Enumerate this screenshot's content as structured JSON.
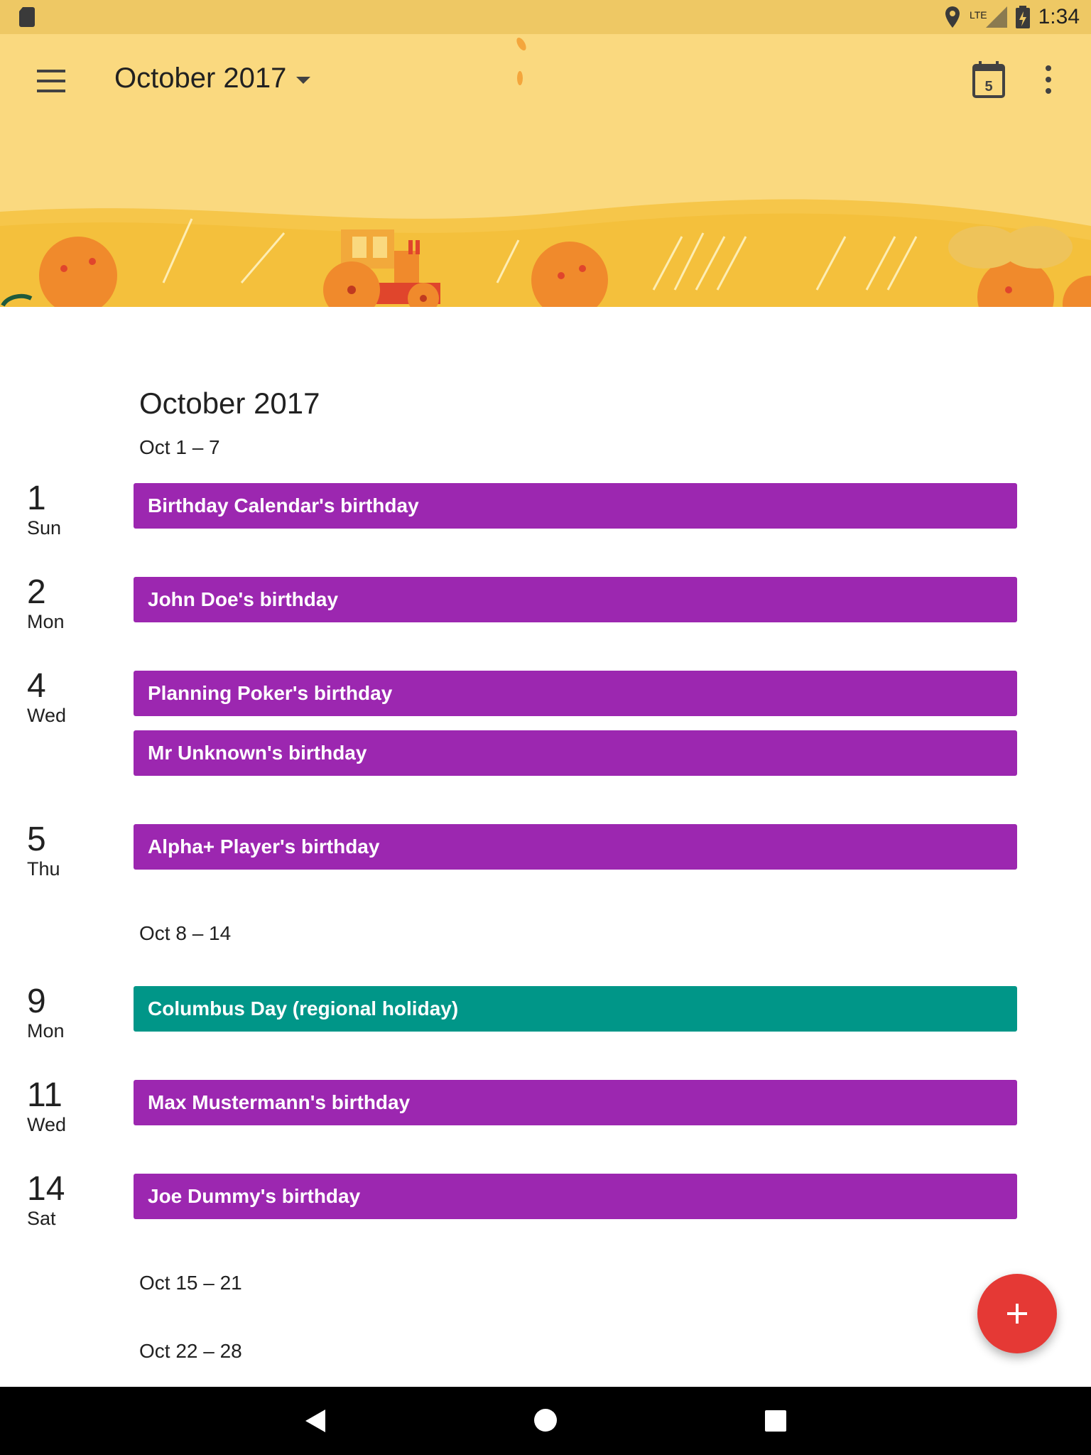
{
  "status_bar": {
    "time": "1:34",
    "network": "LTE"
  },
  "toolbar": {
    "title": "October 2017",
    "today_badge": "5"
  },
  "month_heading": "October 2017",
  "weeks": [
    {
      "label": "Oct 1 – 7"
    },
    {
      "label": "Oct 8 – 14"
    },
    {
      "label": "Oct 15 – 21"
    },
    {
      "label": "Oct 22 – 28"
    }
  ],
  "days": [
    {
      "num": "1",
      "name": "Sun"
    },
    {
      "num": "2",
      "name": "Mon"
    },
    {
      "num": "4",
      "name": "Wed"
    },
    {
      "num": "5",
      "name": "Thu"
    },
    {
      "num": "9",
      "name": "Mon"
    },
    {
      "num": "11",
      "name": "Wed"
    },
    {
      "num": "14",
      "name": "Sat"
    }
  ],
  "events": [
    {
      "title": "Birthday Calendar's birthday",
      "color": "#9c27b0"
    },
    {
      "title": "John Doe's birthday",
      "color": "#9c27b0"
    },
    {
      "title": "Planning Poker's birthday",
      "color": "#9c27b0"
    },
    {
      "title": "Mr Unknown's birthday",
      "color": "#9c27b0"
    },
    {
      "title": "Alpha+ Player's birthday",
      "color": "#9c27b0"
    },
    {
      "title": "Columbus Day (regional holiday)",
      "color": "#009688"
    },
    {
      "title": "Max Mustermann's birthday",
      "color": "#9c27b0"
    },
    {
      "title": "Joe Dummy's birthday",
      "color": "#9c27b0"
    }
  ],
  "icons": {
    "menu": "hamburger-menu-icon",
    "dropdown": "caret-down-icon",
    "today": "calendar-today-icon",
    "more": "more-vert-icon",
    "fab": "plus-icon",
    "back": "nav-back-icon",
    "home": "nav-home-icon",
    "recents": "nav-recents-icon"
  },
  "colors": {
    "birthday": "#9c27b0",
    "holiday": "#009688",
    "fab": "#e53935",
    "header_bg": "#fad97f"
  }
}
